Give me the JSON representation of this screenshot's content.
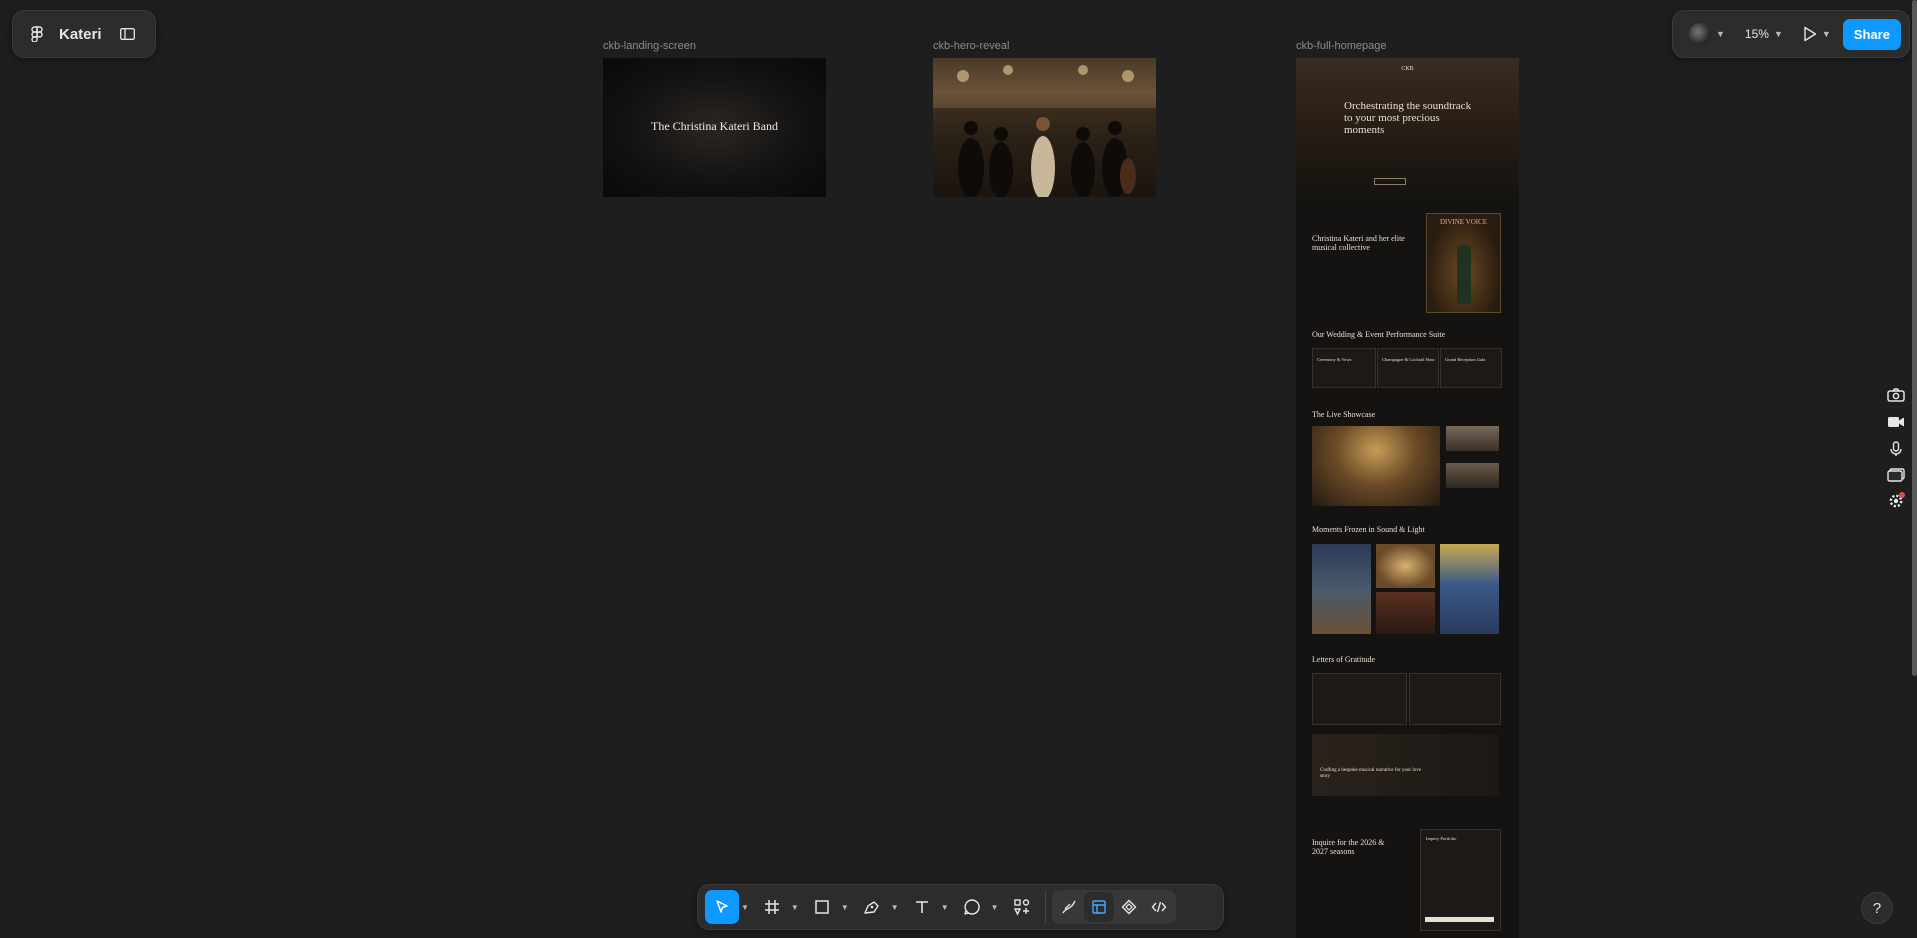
{
  "file": {
    "name": "Kateri"
  },
  "toolbar_right": {
    "zoom": "15%",
    "share_label": "Share"
  },
  "frames": [
    {
      "label": "ckb-landing-screen",
      "title": "The Christina Kateri Band"
    },
    {
      "label": "ckb-hero-reveal"
    },
    {
      "label": "ckb-full-homepage"
    }
  ],
  "homepage": {
    "logo": "CKB",
    "hero_title": "Orchestrating the soundtrack to your most precious moments",
    "about_title": "Christina Kateri and her elite musical collective",
    "poster_title": "DIVINE VOICE",
    "suite_title": "Our Wedding & Event Performance Suite",
    "suite_cards": [
      "Ceremony & Vows",
      "Champagne & Cocktail Hour",
      "Grand Reception Gala"
    ],
    "showcase_title": "The Live Showcase",
    "moments_title": "Moments Frozen in Sound & Light",
    "letters_title": "Letters of Gratitude",
    "bespoke_title": "Crafting a bespoke musical narrative for your love story",
    "inquire_title": "Inquire for the 2026 & 2027 seasons",
    "inquiry_form_title": "Inquiry Portfolio"
  },
  "colors": {
    "canvas": "#1e1e1e",
    "panel": "#2c2c2c",
    "accent": "#0d99ff"
  },
  "icons": {
    "file_menu": "figma-logo-icon",
    "sidebar": "sidebar-toggle-icon",
    "present": "play-icon",
    "tools": [
      "move-icon",
      "frame-icon",
      "rectangle-icon",
      "pen-icon",
      "text-icon",
      "comment-icon",
      "actions-icon"
    ],
    "dev": [
      "draw-icon",
      "design-mode-icon",
      "component-icon",
      "code-icon"
    ],
    "side": [
      "camera-icon",
      "video-icon",
      "microphone-icon",
      "window-icon",
      "settings-icon"
    ]
  }
}
